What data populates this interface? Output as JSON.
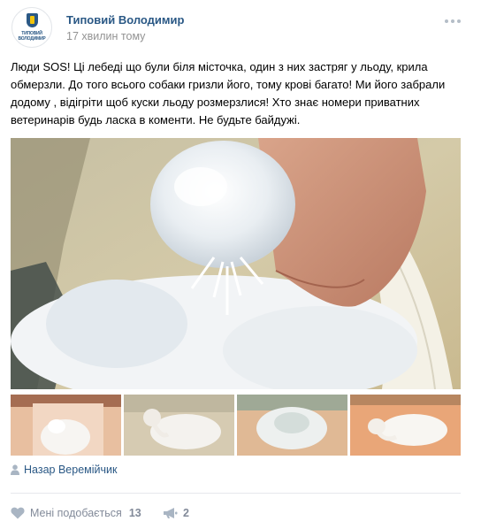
{
  "post": {
    "author": "Типовий Володимир",
    "time": "17 хвилин тому",
    "avatar_wordmark": "ТИПОВИЙ ВОЛОДИМИР",
    "text": "Люди SOS! Ці лебеді що були біля місточка, один з них застряг у льоду, крила обмерзли. До того всього собаки гризли його, тому крові багато! Ми його забрали додому , відігріти щоб куски льоду розмерзлися! Хто знає номери приватних ветеринарів будь ласка в коменти. Не будьте байдужі.",
    "signer": "Назар Веремійчик",
    "icons": {
      "more": "more-dots-icon",
      "signer": "person-icon",
      "like": "heart-icon",
      "share": "megaphone-icon"
    }
  },
  "footer": {
    "like_label": "Мені подобається",
    "like_count": "13",
    "share_count": "2"
  },
  "colors": {
    "link": "#2a5885",
    "muted": "#939393",
    "action": "#828a99",
    "divider": "#e7e8ec"
  }
}
